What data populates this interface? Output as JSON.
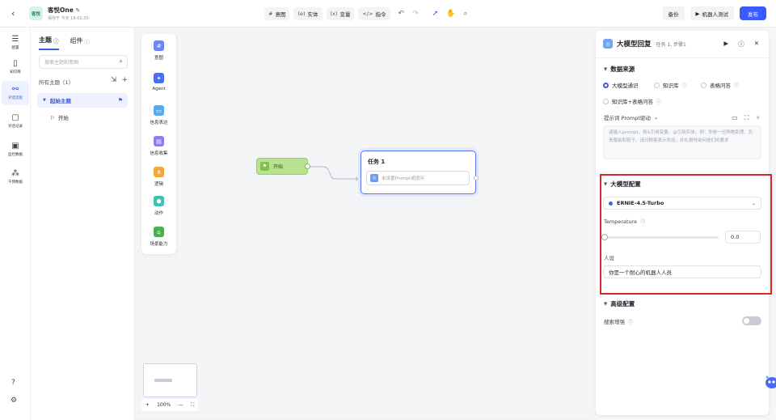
{
  "header": {
    "back_icon": "back-arrow-icon",
    "app_badge": "客悦",
    "app_name": "客悦One",
    "save_status": "保存于 今天 18:01:30",
    "tools": [
      {
        "icon": "#",
        "label": "意图"
      },
      {
        "icon": "(e)",
        "label": "实体"
      },
      {
        "icon": "(x)",
        "label": "变量"
      },
      {
        "icon": "</>",
        "label": "指令"
      }
    ],
    "backup_label": "备份",
    "test_label": "机器人测试",
    "publish_label": "发布"
  },
  "nav": {
    "items": [
      {
        "label": "配置",
        "icon": "sliders-icon"
      },
      {
        "label": "知识库",
        "icon": "book-icon"
      },
      {
        "label": "对话流程",
        "icon": "flow-icon"
      },
      {
        "label": "对话记录",
        "icon": "chat-icon"
      },
      {
        "label": "监控数据",
        "icon": "chart-icon"
      },
      {
        "label": "干预数据",
        "icon": "cluster-icon"
      }
    ]
  },
  "topic_panel": {
    "tab_topic": "主题",
    "tab_component": "组件",
    "search_placeholder": "搜索主题和意图",
    "all_topics": "所有主题（1）",
    "topic": "起始主题",
    "sub": "开始"
  },
  "palette": {
    "items": [
      {
        "label": "意图",
        "glyph": "#",
        "color": "#6b86f5"
      },
      {
        "label": "Agent",
        "glyph": "✦",
        "color": "#4c6cf2"
      },
      {
        "label": "信息表达",
        "glyph": "▭",
        "color": "#57a9f0"
      },
      {
        "label": "信息收集",
        "glyph": "▤",
        "color": "#8f7cf2"
      },
      {
        "label": "逻辑",
        "glyph": "⋔",
        "color": "#f2a93b"
      },
      {
        "label": "动作",
        "glyph": "⬢",
        "color": "#3fc0b0"
      },
      {
        "label": "场景能力",
        "glyph": "⌂",
        "color": "#4caf50"
      }
    ]
  },
  "canvas": {
    "start_label": "开始",
    "task_title": "任务 1",
    "task_placeholder": "未设置Prompt或提问",
    "zoom": "100%"
  },
  "props": {
    "title": "大模型回复",
    "subtitle": "任务 1, 步骤1",
    "data_source": "数据来源",
    "radios": [
      "大模型通识",
      "知识库",
      "表格问答",
      "知识库+表格问答"
    ],
    "selected_radio": "大模型通识",
    "prompt_label": "提示词  Prompt驱动",
    "prompt_placeholder": "请输入prompt，用&引用变量，@引用实体。例：你是一位购物助理，负责服装和鞋子。请对顾客表示欢迎，并礼貌地询问他们的要求",
    "llm_config": "大模型配置",
    "model": "ERNIE-4.5-Turbo",
    "temperature_label": "Temperature",
    "temperature": "0.0",
    "temperature_value": 0.0,
    "persona_label": "人设",
    "persona_value": "你是一个耐心的机器人人员",
    "advanced": "高级配置",
    "search_enhance": "搜索增强",
    "search_enhance_on": false
  },
  "colors": {
    "accent": "#3b5bdb",
    "publish": "#3b5bff",
    "highlight_border": "#d62a2a"
  }
}
